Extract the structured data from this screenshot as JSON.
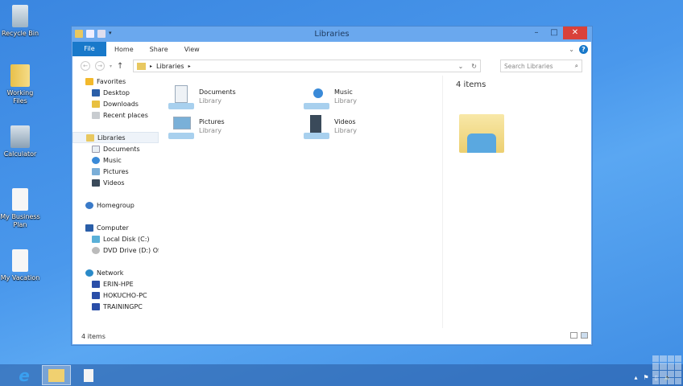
{
  "desktop": {
    "icons": [
      {
        "label": "Recycle Bin",
        "icon": "recycle-bin-icon"
      },
      {
        "label": "Working Files",
        "icon": "folder-icon"
      },
      {
        "label": "Calculator",
        "icon": "calculator-icon"
      },
      {
        "label": "My Business Plan",
        "icon": "document-icon"
      },
      {
        "label": "My Vacation",
        "icon": "document-icon"
      }
    ]
  },
  "window": {
    "title": "Libraries",
    "controls": {
      "minimize": "–",
      "maximize": "□",
      "close": "✕"
    }
  },
  "ribbon": {
    "file": "File",
    "tabs": [
      "Home",
      "Share",
      "View"
    ],
    "help": "?"
  },
  "address": {
    "crumb": "Libraries",
    "search_placeholder": "Search Libraries"
  },
  "nav": {
    "favorites": {
      "label": "Favorites",
      "items": [
        "Desktop",
        "Downloads",
        "Recent places"
      ]
    },
    "libraries": {
      "label": "Libraries",
      "items": [
        "Documents",
        "Music",
        "Pictures",
        "Videos"
      ]
    },
    "homegroup": {
      "label": "Homegroup"
    },
    "computer": {
      "label": "Computer",
      "items": [
        "Local Disk (C:)",
        "DVD Drive (D:) Office"
      ]
    },
    "network": {
      "label": "Network",
      "items": [
        "ERIN-HPE",
        "HOKUCHO-PC",
        "TRAININGPC"
      ]
    }
  },
  "libraries": [
    {
      "name": "Documents",
      "type": "Library"
    },
    {
      "name": "Music",
      "type": "Library"
    },
    {
      "name": "Pictures",
      "type": "Library"
    },
    {
      "name": "Videos",
      "type": "Library"
    }
  ],
  "details": {
    "count": "4 items"
  },
  "status": {
    "count": "4 items"
  },
  "colors": {
    "accent": "#1979ca",
    "close": "#d9413a",
    "titlebar": "#6aa8ee"
  }
}
